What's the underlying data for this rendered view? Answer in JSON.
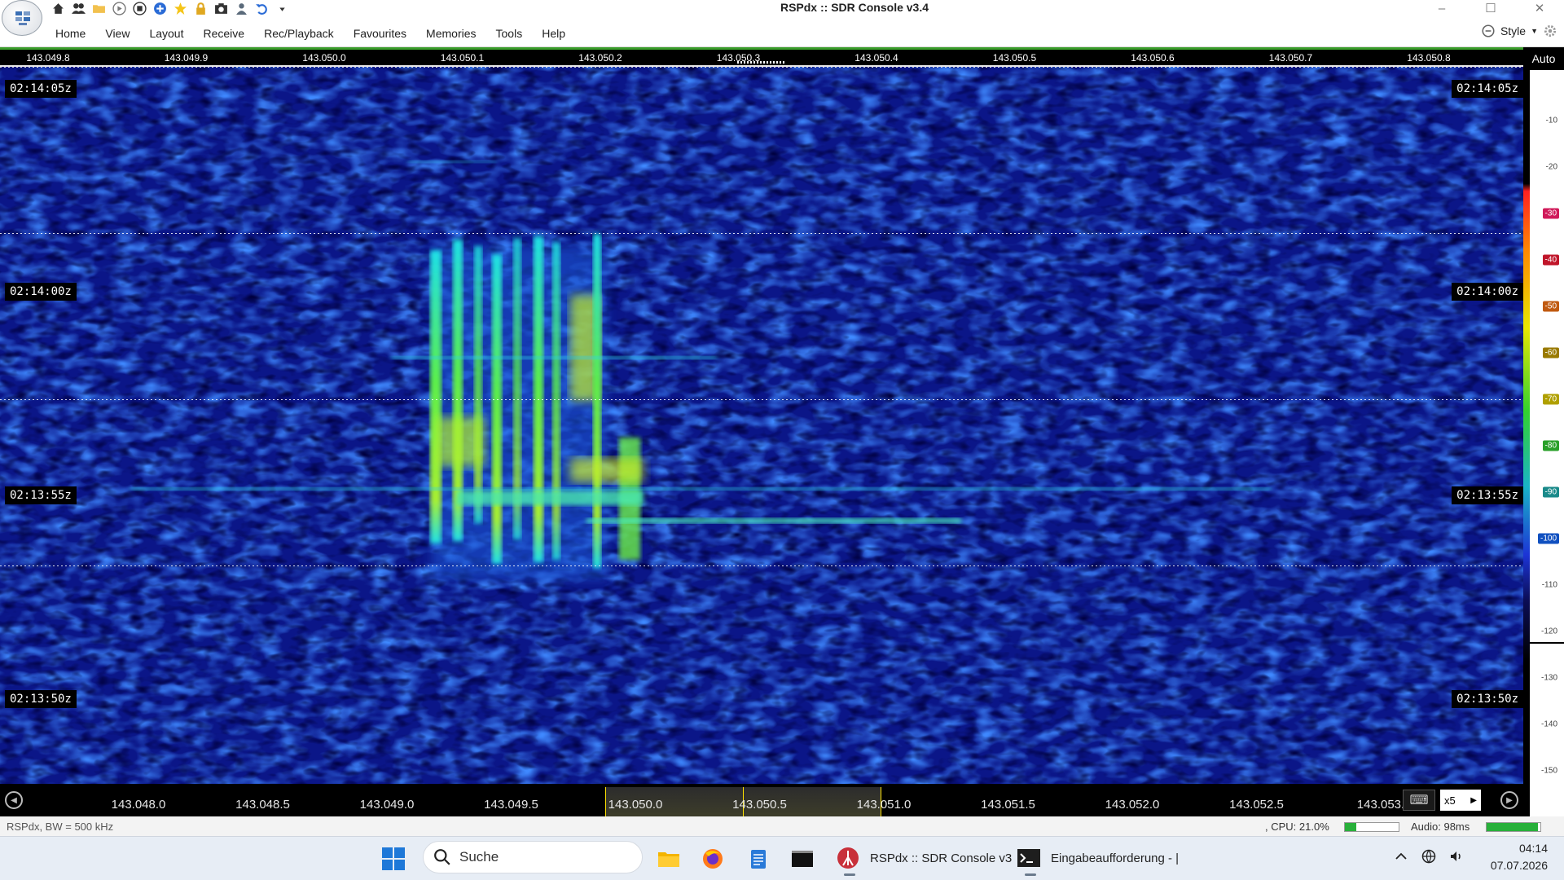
{
  "window": {
    "title": "RSPdx :: SDR Console v3.4",
    "minimize": "–",
    "maximize": "☐",
    "close": "✕"
  },
  "menu": {
    "items": [
      "Home",
      "View",
      "Layout",
      "Receive",
      "Rec/Playback",
      "Favourites",
      "Memories",
      "Tools",
      "Help"
    ],
    "style_label": "Style"
  },
  "top_ruler": {
    "labels": [
      "143.049.8",
      "143.049.9",
      "143.050.0",
      "143.050.1",
      "143.050.2",
      "143.050.3",
      "143.050.4",
      "143.050.5",
      "143.050.6",
      "143.050.7",
      "143.050.8"
    ]
  },
  "auto_button": "Auto",
  "waterfall": {
    "time_labels": [
      "02:14:05z",
      "02:14:00z",
      "02:13:55z",
      "02:13:50z"
    ]
  },
  "scale": {
    "ticks": [
      "-10",
      "-20",
      "-30",
      "-40",
      "-50",
      "-60",
      "-70",
      "-80",
      "-90",
      "-100",
      "-110",
      "-120",
      "-130",
      "-140",
      "-150"
    ],
    "highlight_colors": [
      "#d01a5a",
      "#c0162a",
      "#c05a10",
      "#9a7a00",
      "#b0a000",
      "#2aa02a",
      "#1a8a8a",
      "#1050c0"
    ]
  },
  "bottom_axis": {
    "labels": [
      "143.048.0",
      "143.048.5",
      "143.049.0",
      "143.049.5",
      "143.050.0",
      "143.050.5",
      "143.051.0",
      "143.051.5",
      "143.052.0",
      "143.052.5",
      "143.053."
    ],
    "zoom": "x5"
  },
  "status": {
    "left": "RSPdx, BW = 500 kHz",
    "cpu": ", CPU: 21.0%",
    "cpu_level": 0.21,
    "audio": "Audio: 98ms",
    "audio_level": 0.95
  },
  "taskbar": {
    "search_placeholder": "Suche",
    "app1": "RSPdx :: SDR Console v3",
    "app2": "Eingabeaufforderung - |",
    "time": "04:14",
    "date": "07.07.2026"
  },
  "colors": {
    "waterfall_bg": "#0a1480",
    "signal_green": "#5cf04a",
    "signal_cyan": "#1ee0e8",
    "accent_yellow": "#ffe200"
  }
}
